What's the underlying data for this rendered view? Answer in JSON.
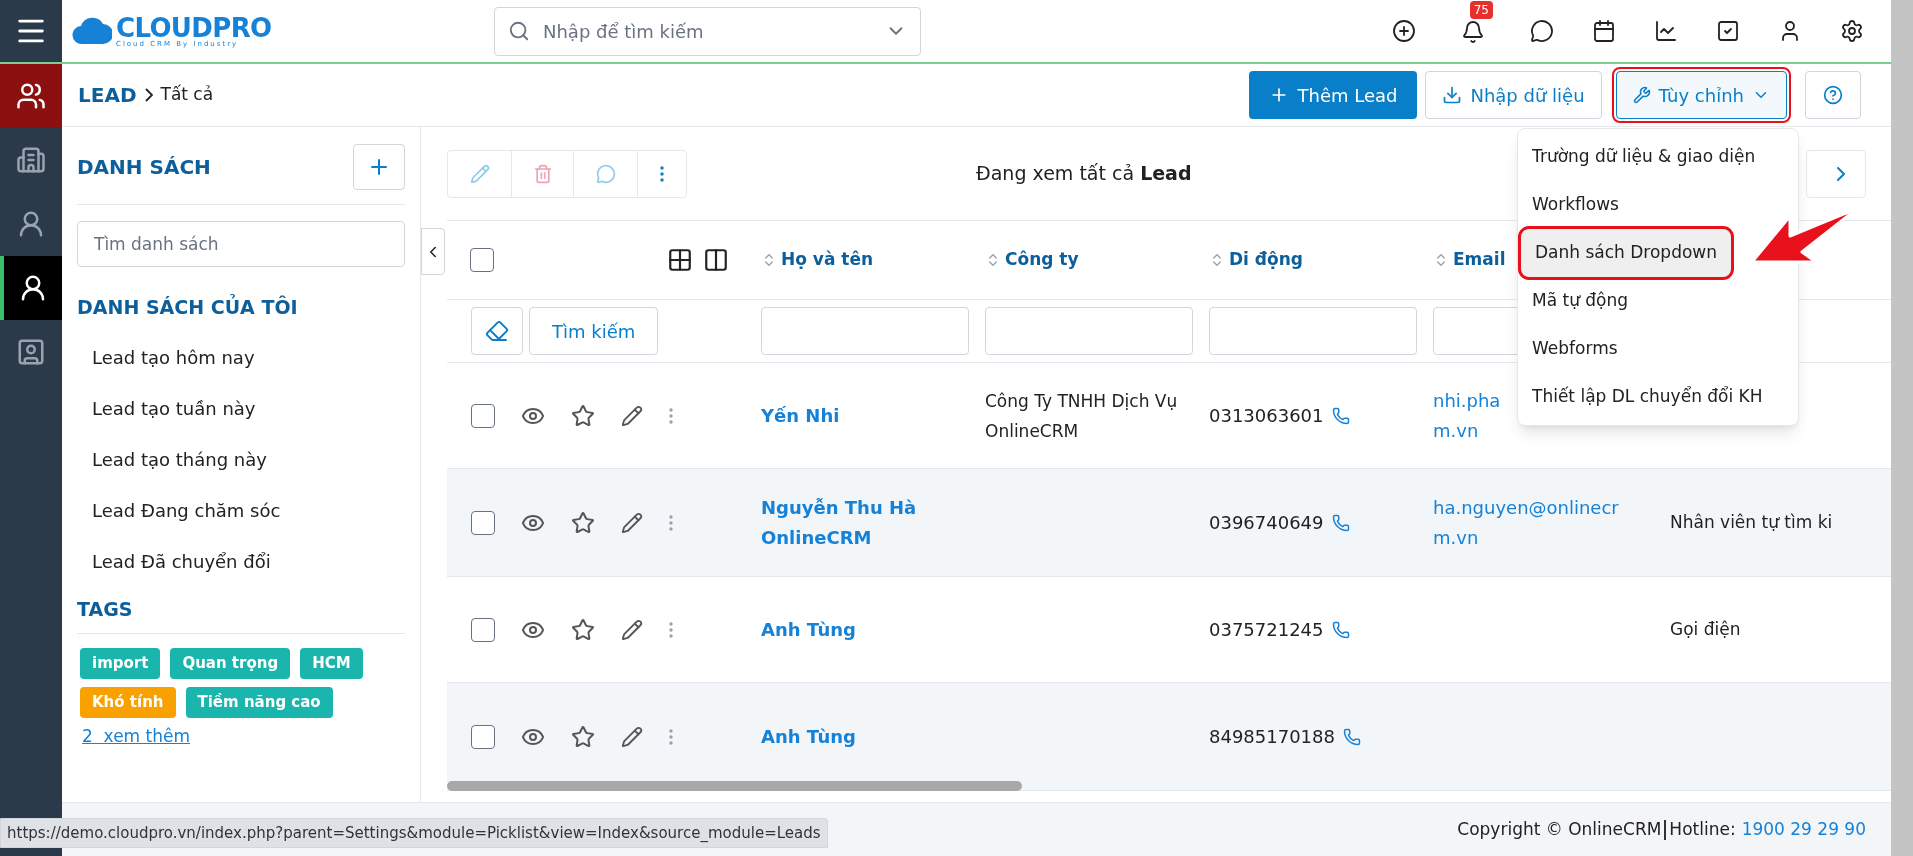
{
  "top_bar": {
    "logo": {
      "name": "CLOUDPRO",
      "tagline": "Cloud CRM By Industry"
    },
    "search": {
      "placeholder": "Nhập để tìm kiếm"
    },
    "notification_count": "75"
  },
  "rail": [
    {
      "active_module": true,
      "selected": false
    },
    {
      "active_module": false,
      "selected": false
    },
    {
      "active_module": false,
      "selected": false
    },
    {
      "active_module": false,
      "selected": true
    },
    {
      "active_module": false,
      "selected": false
    }
  ],
  "breadcrumb": {
    "module": "LEAD",
    "page": "Tất cả"
  },
  "actions": [
    {
      "kind": "primary",
      "label": "Thêm Lead",
      "highlighted": false
    },
    {
      "kind": "import",
      "label": "Nhập dữ liệu",
      "highlighted": false
    },
    {
      "kind": "menu",
      "label": "Tùy chỉnh",
      "highlighted": true,
      "expanded": true
    },
    {
      "kind": "help",
      "highlighted": false
    }
  ],
  "sidebar": {
    "title": "DANH SÁCH",
    "search": {
      "placeholder": "Tìm danh sách"
    },
    "section": "DANH SÁCH CỦA TÔI",
    "lists": [
      "Lead tạo hôm nay",
      "Lead tạo tuần này",
      "Lead tạo tháng này",
      "Lead Đang chăm sóc",
      "Lead Đã chuyển đổi"
    ],
    "tags_title": "TAGS",
    "tags": [
      {
        "label": "import",
        "color": "#1ab6ad"
      },
      {
        "label": "Quan trọng",
        "color": "#1ab6ad"
      },
      {
        "label": "HCM",
        "color": "#1ab6ad"
      },
      {
        "label": "Khó tính",
        "color": "#f8a100"
      },
      {
        "label": "Tiềm năng cao",
        "color": "#1ab6ad"
      }
    ],
    "more_link": "2  xem thêm"
  },
  "toolbar": {
    "view_text": "Đang xem tất cả **Lead**"
  },
  "table": {
    "columns": [
      "Họ và tên",
      "Công ty",
      "Di động",
      "Email"
    ],
    "search_button": "Tìm kiếm",
    "header_checked": false,
    "rows": [
      {
        "checked": false,
        "name": "Yến Nhi",
        "company": "Công Ty TNHH Dịch Vụ OnlineCRM",
        "mobile": "0313063601",
        "email_lines": [
          "nhi.pha",
          "m.vn"
        ]
      },
      {
        "checked": false,
        "name": "Nguyễn Thu Hà OnlineCRM",
        "mobile": "0396740649",
        "email_lines": [
          "ha.nguyen@onlinecr",
          "m.vn"
        ],
        "column_5": "Nhân viên tự tìm ki"
      },
      {
        "checked": false,
        "name": "Anh Tùng",
        "mobile": "0375721245",
        "column_5": "Gọi điện"
      },
      {
        "checked": false,
        "name": "Anh Tùng",
        "mobile": "84985170188"
      }
    ]
  },
  "dropdown": {
    "items": [
      {
        "label": "Trường dữ liệu & giao diện",
        "selected": false
      },
      {
        "label": "Workflows",
        "selected": false
      },
      {
        "label": "Danh sách Dropdown",
        "selected": true
      },
      {
        "label": "Mã tự động",
        "selected": false
      },
      {
        "label": "Webforms",
        "selected": false
      },
      {
        "label": "Thiết lập DL chuyển đổi KH",
        "selected": false
      }
    ]
  },
  "footer": {
    "copyright": "Copyright © OnlineCRM",
    "hotline_label": "Hotline:",
    "hotline": "1900 29 29 90",
    "status_url": "https://demo.cloudpro.vn/index.php?parent=Settings&module=Picklist&view=Index&source_module=Leads"
  }
}
